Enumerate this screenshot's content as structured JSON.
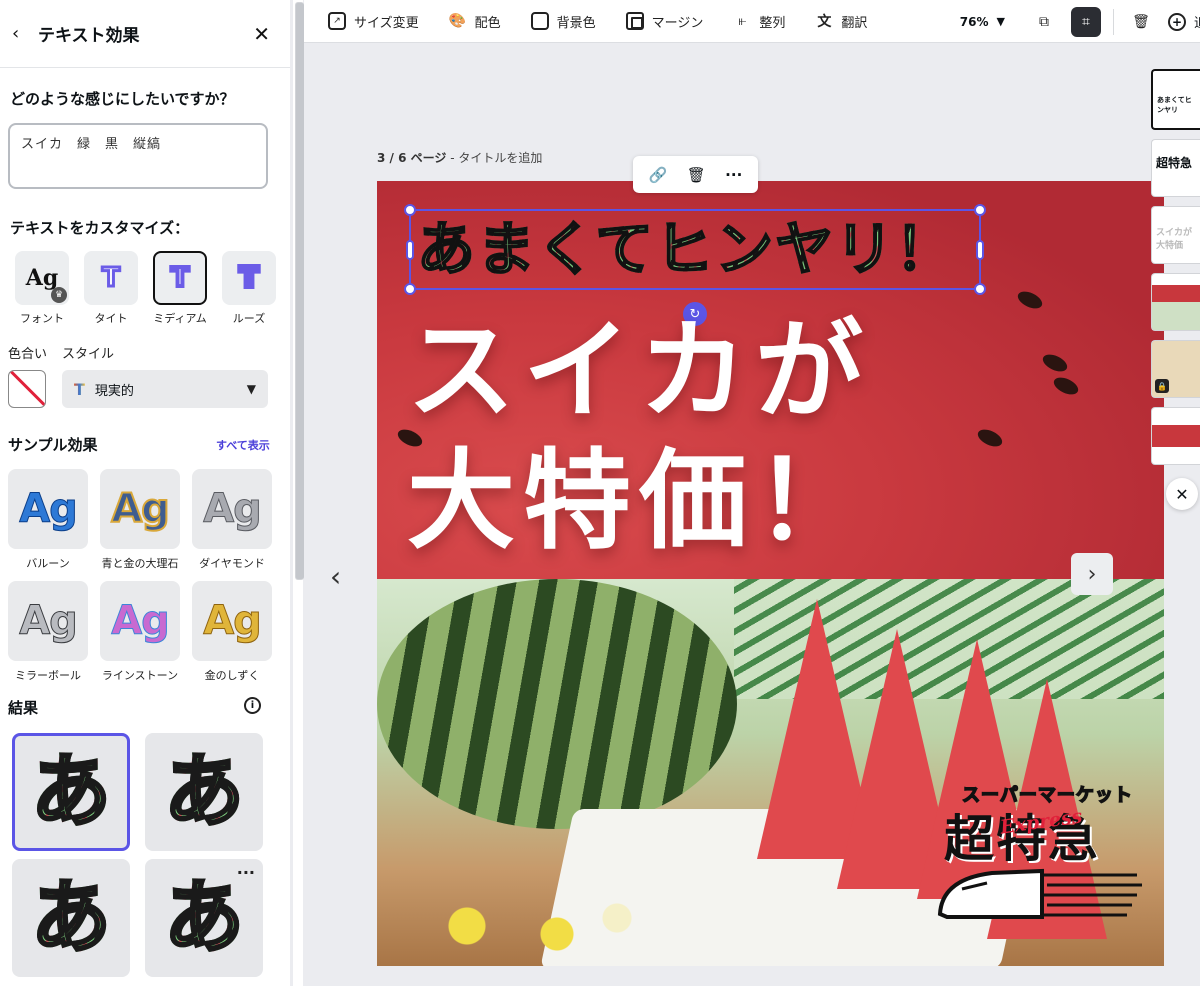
{
  "panel": {
    "title": "テキスト効果",
    "question": "どのような感じにしたいですか？",
    "prompt_value": "スイカ　緑　黒　縦縞",
    "customize_title": "テキストをカスタマイズ：",
    "customize_items": [
      {
        "label": "フォント",
        "glyph": "Ag"
      },
      {
        "label": "タイト",
        "glyph": "T"
      },
      {
        "label": "ミディアム",
        "glyph": "T"
      },
      {
        "label": "ルーズ",
        "glyph": "T"
      }
    ],
    "color_label": "色合い",
    "style_label": "スタイル",
    "style_glyph": "T",
    "style_value": "現実的",
    "sample_title": "サンプル効果",
    "see_all": "すべて表示",
    "samples": [
      {
        "label": "バルーン",
        "glyph": "Ag"
      },
      {
        "label": "青と金の大理石",
        "glyph": "Ag"
      },
      {
        "label": "ダイヤモンド",
        "glyph": "Ag"
      },
      {
        "label": "ミラーボール",
        "glyph": "Ag"
      },
      {
        "label": "ラインストーン",
        "glyph": "Ag"
      },
      {
        "label": "金のしずく",
        "glyph": "Ag"
      }
    ],
    "results_title": "結果",
    "results": [
      {
        "glyph": "あ"
      },
      {
        "glyph": "あ"
      },
      {
        "glyph": "あ"
      },
      {
        "glyph": "あ"
      }
    ]
  },
  "toolbar": {
    "items": [
      {
        "label": "サイズ変更",
        "icon": "resize-icon"
      },
      {
        "label": "配色",
        "icon": "palette-icon"
      },
      {
        "label": "背景色",
        "icon": "background-color-icon"
      },
      {
        "label": "マージン",
        "icon": "margin-icon"
      },
      {
        "label": "整列",
        "icon": "align-icon"
      },
      {
        "label": "翻訳",
        "icon": "translate-icon"
      }
    ],
    "zoom": "76%",
    "add_label": "追加"
  },
  "canvas": {
    "page_indicator": "3 / 6 ページ",
    "page_title_link": "タイトルを追加",
    "heading_text": "あまくてヒンヤリ！",
    "title_line1": "スイカが",
    "title_line2": "大特価！",
    "logo_line1": "スーパーマーケット",
    "logo_line2": "超特急",
    "logo_express": "Express"
  },
  "thumbnails": [
    {
      "text": "あまくてヒンヤリ"
    },
    {
      "text": "超特急"
    },
    {
      "text": "スイカが大特価"
    },
    {
      "text": ""
    },
    {
      "text": ""
    },
    {
      "text": ""
    }
  ]
}
